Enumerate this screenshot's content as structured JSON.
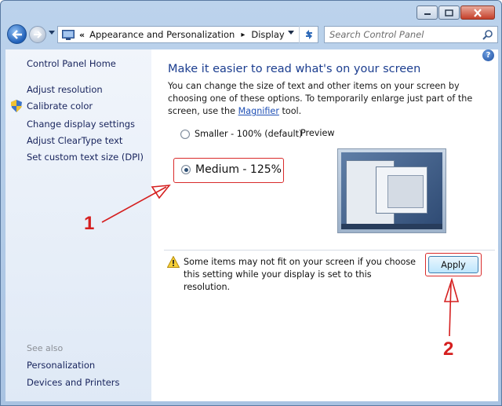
{
  "address_bar": {
    "chevron": "«",
    "segment1": "Appearance and Personalization",
    "separator": "▸",
    "segment2": "Display"
  },
  "search": {
    "placeholder": "Search Control Panel"
  },
  "sidebar": {
    "home": "Control Panel Home",
    "items": [
      "Adjust resolution",
      "Calibrate color",
      "Change display settings",
      "Adjust ClearType text",
      "Set custom text size (DPI)"
    ],
    "see_also_label": "See also",
    "see_also": [
      "Personalization",
      "Devices and Printers"
    ]
  },
  "main": {
    "help_glyph": "?",
    "title": "Make it easier to read what's on your screen",
    "description_part1": "You can change the size of text and other items on your screen by choosing one of these options. To temporarily enlarge just part of the screen, use the ",
    "magnifier_link": "Magnifier",
    "description_part2": " tool.",
    "options": [
      {
        "label": "Smaller - 100% (default)",
        "checked": false
      },
      {
        "label": "Medium - 125%",
        "checked": true
      }
    ],
    "preview_label": "Preview",
    "warning": "Some items may not fit on your screen if you choose this setting while your display is set to this resolution.",
    "apply_label": "Apply"
  },
  "annotations": {
    "step1": "1",
    "step2": "2",
    "highlight_color": "#d92b2b"
  },
  "icons": {
    "back": "back-arrow-icon",
    "forward": "forward-arrow-icon",
    "refresh": "refresh-icon",
    "search": "search-icon",
    "shield": "uac-shield-icon",
    "warning": "warning-icon",
    "help": "help-icon"
  }
}
